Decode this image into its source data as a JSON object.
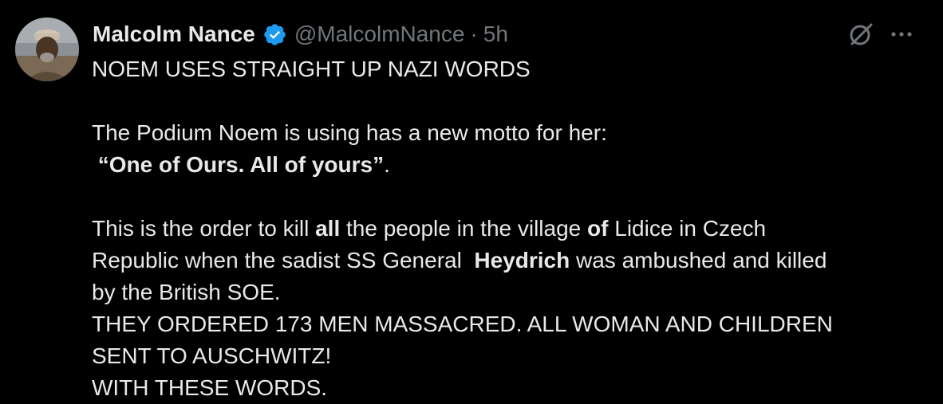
{
  "author": {
    "name": "Malcolm Nance",
    "handle": "@MalcolmNance",
    "separator": "·",
    "time": "5h",
    "verified_icon": "verified-badge-icon",
    "verified_color": "#1d9bf0"
  },
  "actions": {
    "grok_icon": "grok-icon",
    "more_icon": "more-options-icon"
  },
  "post": {
    "line1": "NOEM USES STRAIGHT UP NAZI WORDS",
    "line2": "The Podium Noem is using has a new motto for her:",
    "line3_quote": "“One of Ours. All of yours”",
    "line3_end": ".",
    "line4_a": "This is the order to kill ",
    "line4_b": "all",
    "line4_c": " the people in the village ",
    "line4_d": "of",
    "line4_e": " Lidice in Czech",
    "line5_a": "Republic when the sadist SS General  ",
    "line5_b": "Heydrich",
    "line5_c": " was ambushed and killed",
    "line6": "by the British SOE.",
    "line7": "THEY ORDERED 173 MEN MASSACRED. ALL WOMAN AND CHILDREN",
    "line8": "SENT TO AUSCHWITZ!",
    "line9": "WITH THESE WORDS."
  },
  "colors": {
    "background": "#000000",
    "text": "#e7e9ea",
    "muted": "#71767b"
  }
}
